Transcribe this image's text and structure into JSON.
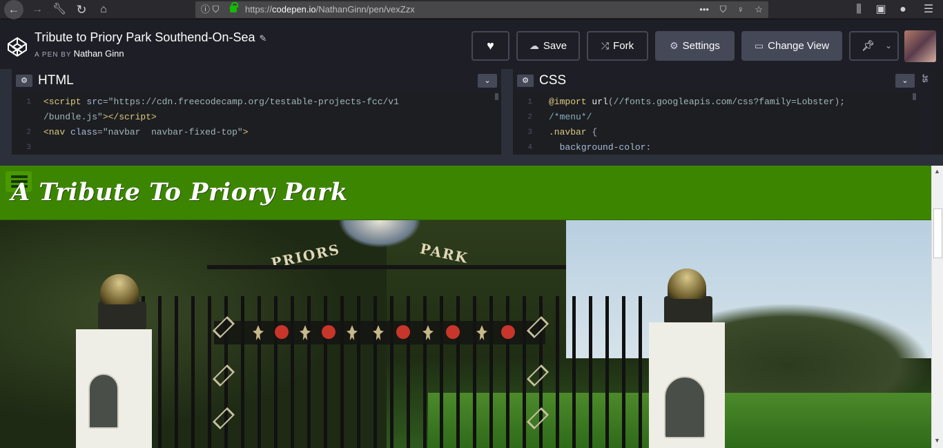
{
  "browser": {
    "url_prefix": "https://",
    "url_domain": "codepen.io",
    "url_path": "/NathanGinn/pen/vexZzx",
    "info_icon": "info-icon",
    "actions": [
      "•••",
      "pocket-icon",
      "lightbulb-icon",
      "star-icon"
    ]
  },
  "pen": {
    "title": "Tribute to Priory Park Southend-On-Sea",
    "by_label": "A PEN BY",
    "author": "Nathan Ginn"
  },
  "header_buttons": {
    "save": "Save",
    "fork": "Fork",
    "settings": "Settings",
    "change_view": "Change View"
  },
  "editors": {
    "html": {
      "title": "HTML",
      "line_numbers": [
        "1",
        "",
        "2",
        "3"
      ]
    },
    "css": {
      "title": "CSS",
      "line_numbers": [
        "1",
        "2",
        "3",
        "4"
      ]
    },
    "js_label": "JS"
  },
  "preview": {
    "site_title": "A Tribute To Priory Park",
    "arch_left": "PRIORS",
    "arch_right": "PARK"
  },
  "colors": {
    "navbar": "#3c8500",
    "header_bg": "#1e1f26",
    "button_fill": "#444857"
  }
}
